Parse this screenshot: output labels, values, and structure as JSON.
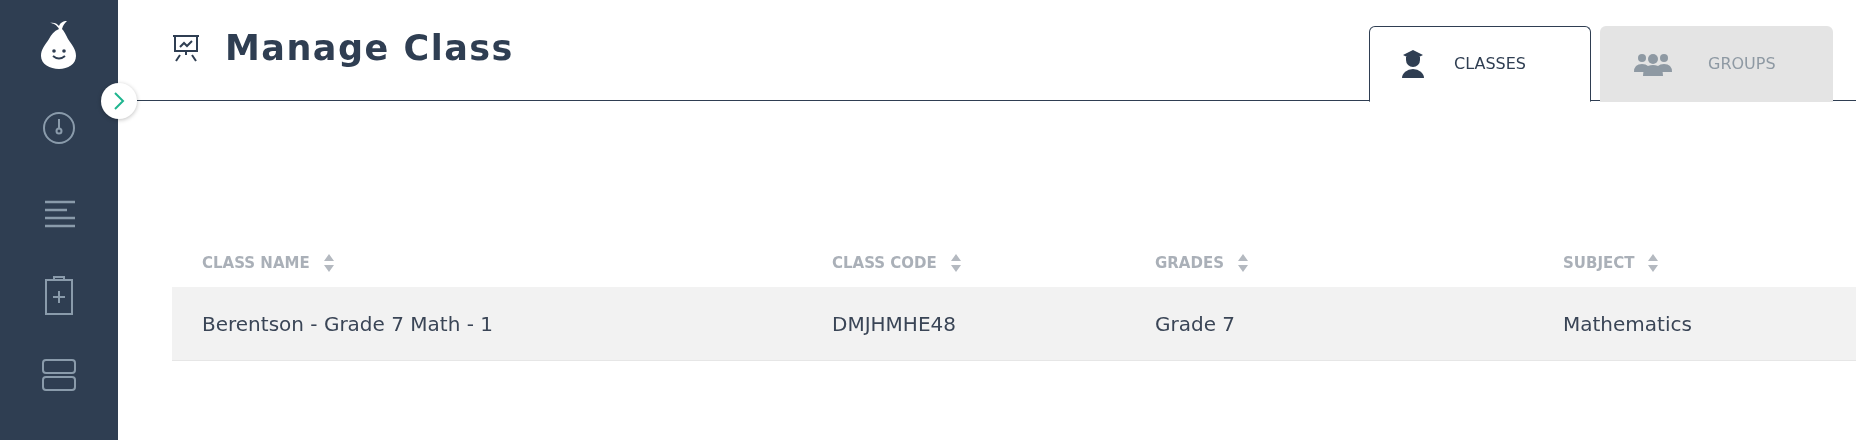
{
  "page": {
    "title": "Manage Class"
  },
  "tabs": [
    {
      "label": "CLASSES",
      "selected": true,
      "kind": "classes"
    },
    {
      "label": "GROUPS",
      "selected": false,
      "kind": "groups"
    }
  ],
  "table": {
    "columns": [
      "CLASS NAME",
      "CLASS CODE",
      "GRADES",
      "SUBJECT"
    ],
    "rows": [
      {
        "cells": [
          "Berentson - Grade 7 Math - 1",
          "DMJHMHE48",
          "Grade 7",
          "Mathematics"
        ],
        "selected": true
      }
    ]
  }
}
